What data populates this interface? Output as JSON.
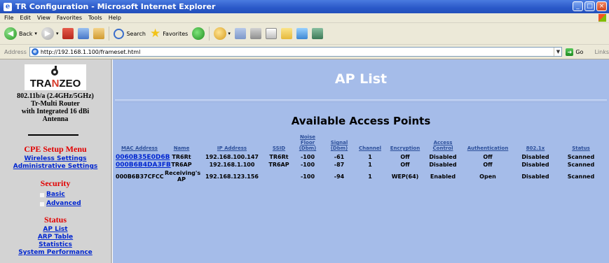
{
  "window": {
    "title": "TR Configuration - Microsoft Internet Explorer"
  },
  "menubar": {
    "items": [
      "File",
      "Edit",
      "View",
      "Favorites",
      "Tools",
      "Help"
    ]
  },
  "toolbar": {
    "back": "Back",
    "search": "Search",
    "favorites": "Favorites"
  },
  "addressbar": {
    "label": "Address",
    "url": "http://192.168.1.100/frameset.html",
    "go": "Go",
    "links": "Links"
  },
  "sidebar": {
    "logo_parts": [
      "TRA",
      "N",
      "ZEO"
    ],
    "product_lines": [
      "802.11b/a (2.4GHz/5GHz)",
      "Tr-Multi Router",
      "with Integrated 16 dBi",
      "Antenna"
    ],
    "setup_heading": "CPE Setup Menu",
    "setup_links": [
      "Wireless Settings",
      "Administrative Settings"
    ],
    "security_heading": "Security",
    "security_links": [
      "Basic",
      "Advanced"
    ],
    "status_heading": "Status",
    "status_links": [
      "AP List",
      "ARP Table",
      "Statistics",
      "System Performance"
    ]
  },
  "main": {
    "title": "AP List",
    "section_title": "Available Access Points",
    "columns": [
      [
        "MAC Address"
      ],
      [
        "Name"
      ],
      [
        "IP Address"
      ],
      [
        "SSID"
      ],
      [
        "Noise",
        "Floor",
        "(Dbm)"
      ],
      [
        "Signal",
        "(Dbm)"
      ],
      [
        "Channel"
      ],
      [
        "Encryption"
      ],
      [
        "Access",
        "Control"
      ],
      [
        "Authentication"
      ],
      [
        "802.1x"
      ],
      [
        "Status"
      ]
    ],
    "rows": [
      [
        "0060B35E0D6B",
        "TR6Rt",
        "192.168.100.147",
        "TR6Rt",
        "-100",
        "-61",
        "1",
        "Off",
        "Disabled",
        "Off",
        "Disabled",
        "Scanned"
      ],
      [
        "000B6B4DA3FB",
        "TR6AP",
        "192.168.1.100",
        "TR6AP",
        "-100",
        "-87",
        "1",
        "Off",
        "Disabled",
        "Off",
        "Disabled",
        "Scanned"
      ],
      [
        "000B6B37CFCC",
        "Receiving's AP",
        "192.168.123.156",
        "",
        "-100",
        "-94",
        "1",
        "WEP(64)",
        "Enabled",
        "Open",
        "Disabled",
        "Scanned"
      ]
    ],
    "row_mac_linked": [
      true,
      true,
      false
    ]
  }
}
